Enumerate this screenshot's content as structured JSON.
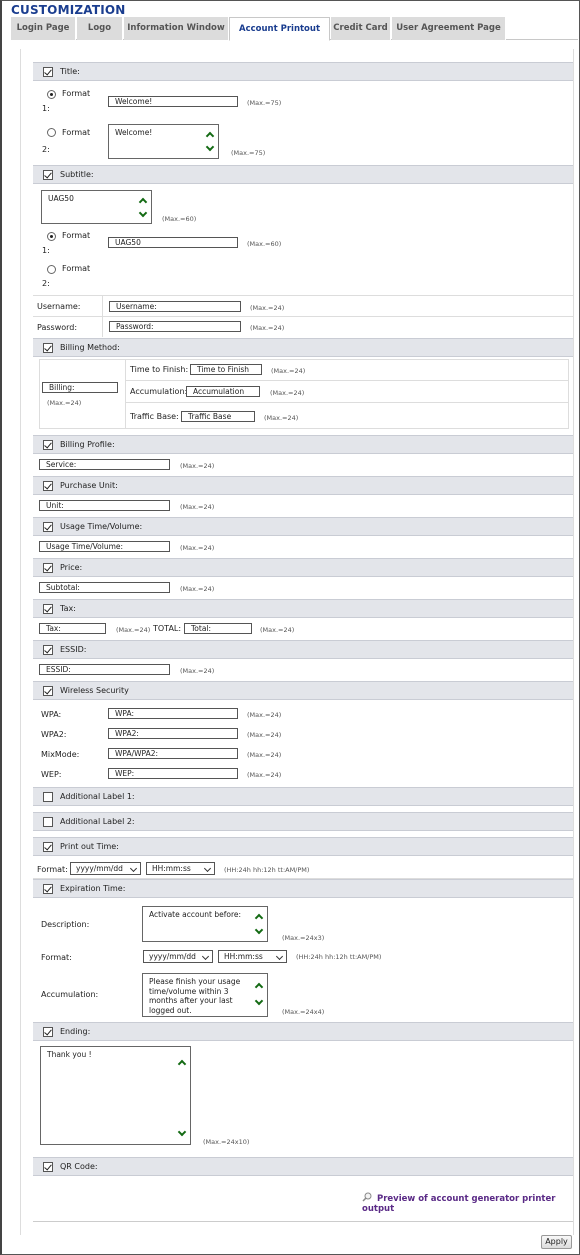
{
  "page_title": "CUSTOMIZATION",
  "tabs": [
    "Login Page",
    "Logo",
    "Information Window",
    "Account Printout",
    "Credit Card",
    "User Agreement Page"
  ],
  "active_tab": "Account Printout",
  "title_section": {
    "label": "Title:",
    "checked": true,
    "format1_label": "Format",
    "format1_num": "1:",
    "format1_value": "Welcome!",
    "format1_hint": "(Max.=75)",
    "format2_label": "Format",
    "format2_num": "2:",
    "format2_value": "Welcome!",
    "format2_hint": "(Max.=75)",
    "selected_format": 1
  },
  "subtitle_section": {
    "label": "Subtitle:",
    "checked": true,
    "textarea_value": "UAG50",
    "textarea_hint": "(Max.=60)",
    "format1_label": "Format",
    "format1_num": "1:",
    "format1_value": "UAG50",
    "format1_hint": "(Max.=60)",
    "format2_label": "Format",
    "format2_num": "2:",
    "selected_format": 1
  },
  "credentials": {
    "username_label": "Username:",
    "username_value": "Username:",
    "username_hint": "(Max.=24)",
    "password_label": "Password:",
    "password_value": "Password:",
    "password_hint": "(Max.=24)"
  },
  "billing_method": {
    "label": "Billing Method:",
    "checked": true,
    "billing_value": "Billing:",
    "billing_hint": "(Max.=24)",
    "time_label": "Time to Finish:",
    "time_value": "Time to Finish",
    "time_hint": "(Max.=24)",
    "accum_label": "Accumulation:",
    "accum_value": "Accumulation",
    "accum_hint": "(Max.=24)",
    "traffic_label": "Traffic Base:",
    "traffic_value": "Traffic Base",
    "traffic_hint": "(Max.=24)"
  },
  "billing_profile": {
    "label": "Billing Profile:",
    "checked": true,
    "value": "Service:",
    "hint": "(Max.=24)"
  },
  "purchase_unit": {
    "label": "Purchase Unit:",
    "checked": true,
    "value": "Unit:",
    "hint": "(Max.=24)"
  },
  "usage": {
    "label": "Usage Time/Volume:",
    "checked": true,
    "value": "Usage Time/Volume:",
    "hint": "(Max.=24)"
  },
  "price": {
    "label": "Price:",
    "checked": true,
    "value": "Subtotal:",
    "hint": "(Max.=24)"
  },
  "tax": {
    "label": "Tax:",
    "checked": true,
    "tax_value": "Tax:",
    "tax_hint": "(Max.=24)",
    "total_label": "TOTAL:",
    "total_value": "Total:",
    "total_hint": "(Max.=24)"
  },
  "essid": {
    "label": "ESSID:",
    "checked": true,
    "value": "ESSID:",
    "hint": "(Max.=24)"
  },
  "wireless": {
    "label": "Wireless Security",
    "checked": true,
    "rows": [
      {
        "label": "WPA:",
        "value": "WPA:",
        "hint": "(Max.=24)"
      },
      {
        "label": "WPA2:",
        "value": "WPA2:",
        "hint": "(Max.=24)"
      },
      {
        "label": "MixMode:",
        "value": "WPA/WPA2:",
        "hint": "(Max.=24)"
      },
      {
        "label": "WEP:",
        "value": "WEP:",
        "hint": "(Max.=24)"
      }
    ]
  },
  "additional1": {
    "label": "Additional Label 1:",
    "checked": false
  },
  "additional2": {
    "label": "Additional Label 2:",
    "checked": false
  },
  "print_time": {
    "label": "Print out Time:",
    "checked": true,
    "format_label": "Format:",
    "date_value": "yyyy/mm/dd",
    "time_value": "HH:mm:ss",
    "hint": "(HH:24h hh:12h tt:AM/PM)"
  },
  "expiration": {
    "label": "Expiration Time:",
    "checked": true,
    "desc_label": "Description:",
    "desc_value": "Activate account before:",
    "desc_hint": "(Max.=24x3)",
    "format_label": "Format:",
    "date_value": "yyyy/mm/dd",
    "time_value": "HH:mm:ss",
    "format_hint": "(HH:24h hh:12h tt:AM/PM)",
    "accum_label": "Accumulation:",
    "accum_value": "Please finish your usage time/volume within 3 months after your last logged out.",
    "accum_hint": "(Max.=24x4)"
  },
  "ending": {
    "label": "Ending:",
    "checked": true,
    "value": "Thank you !",
    "hint": "(Max.=24x10)"
  },
  "qr": {
    "label": "QR Code:",
    "checked": true
  },
  "preview_link": "Preview of account generator printer output",
  "apply_button": "Apply"
}
